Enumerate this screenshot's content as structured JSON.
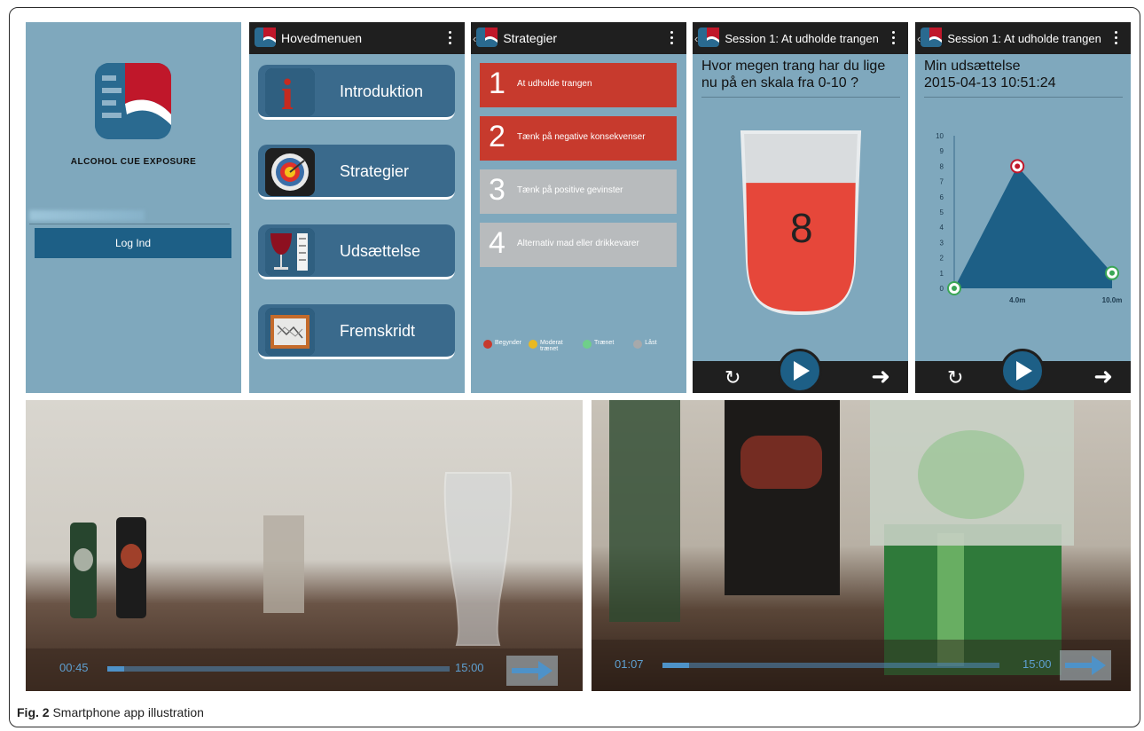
{
  "caption": {
    "label": "Fig. 2",
    "text": "Smartphone app illustration"
  },
  "colors": {
    "screen_bg": "#7fa8bd",
    "active_red": "#c73a2d",
    "locked_grey": "#b8bbbd",
    "button_blue": "#1d5f86",
    "appbar": "#1f1f1f"
  },
  "login": {
    "brand": "ALCOHOL CUE EXPOSURE",
    "button": "Log Ind"
  },
  "main_menu": {
    "title": "Hovedmenuen",
    "items": [
      {
        "label": "Introduktion",
        "icon": "info-icon"
      },
      {
        "label": "Strategier",
        "icon": "target-icon"
      },
      {
        "label": "Udsættelse",
        "icon": "wine-glass-icon"
      },
      {
        "label": "Fremskridt",
        "icon": "progress-board-icon"
      }
    ]
  },
  "strategies": {
    "title": "Strategier",
    "items": [
      {
        "num": "1",
        "label": "At udholde trangen",
        "state": "active"
      },
      {
        "num": "2",
        "label": "Tænk på negative konsekvenser",
        "state": "active"
      },
      {
        "num": "3",
        "label": "Tænk på positive gevinster",
        "state": "locked"
      },
      {
        "num": "4",
        "label": "Alternativ mad eller drikkevarer",
        "state": "locked"
      }
    ],
    "legend": [
      {
        "label": "Begynder",
        "color": "#c73a2d"
      },
      {
        "label": "Moderat trænet",
        "color": "#e8b923"
      },
      {
        "label": "Trænet",
        "color": "#6fcf8a"
      },
      {
        "label": "Låst",
        "color": "#a7a9ab"
      }
    ]
  },
  "rating": {
    "title": "Session 1: At udholde trangen",
    "question": "Hvor megen trang har du lige nu på en skala fra 0-10 ?",
    "value": "8",
    "fill_fraction": 0.72
  },
  "exposure": {
    "title": "Session 1: At udholde trangen",
    "heading": "Min udsættelse",
    "timestamp": "2015-04-13 10:51:24"
  },
  "chart_data": {
    "type": "area",
    "x_ticks": [
      "4.0m",
      "10.0m"
    ],
    "y_ticks": [
      "0",
      "1",
      "2",
      "3",
      "4",
      "5",
      "6",
      "7",
      "8",
      "9",
      "10"
    ],
    "ylim": [
      0,
      10
    ],
    "xlim": [
      0,
      10
    ],
    "points": [
      {
        "x": 0,
        "y": 0
      },
      {
        "x": 4,
        "y": 8
      },
      {
        "x": 10,
        "y": 1
      }
    ]
  },
  "videos": [
    {
      "current": "00:45",
      "total": "15:00",
      "progress": 0.05
    },
    {
      "current": "01:07",
      "total": "15:00",
      "progress": 0.08
    }
  ]
}
